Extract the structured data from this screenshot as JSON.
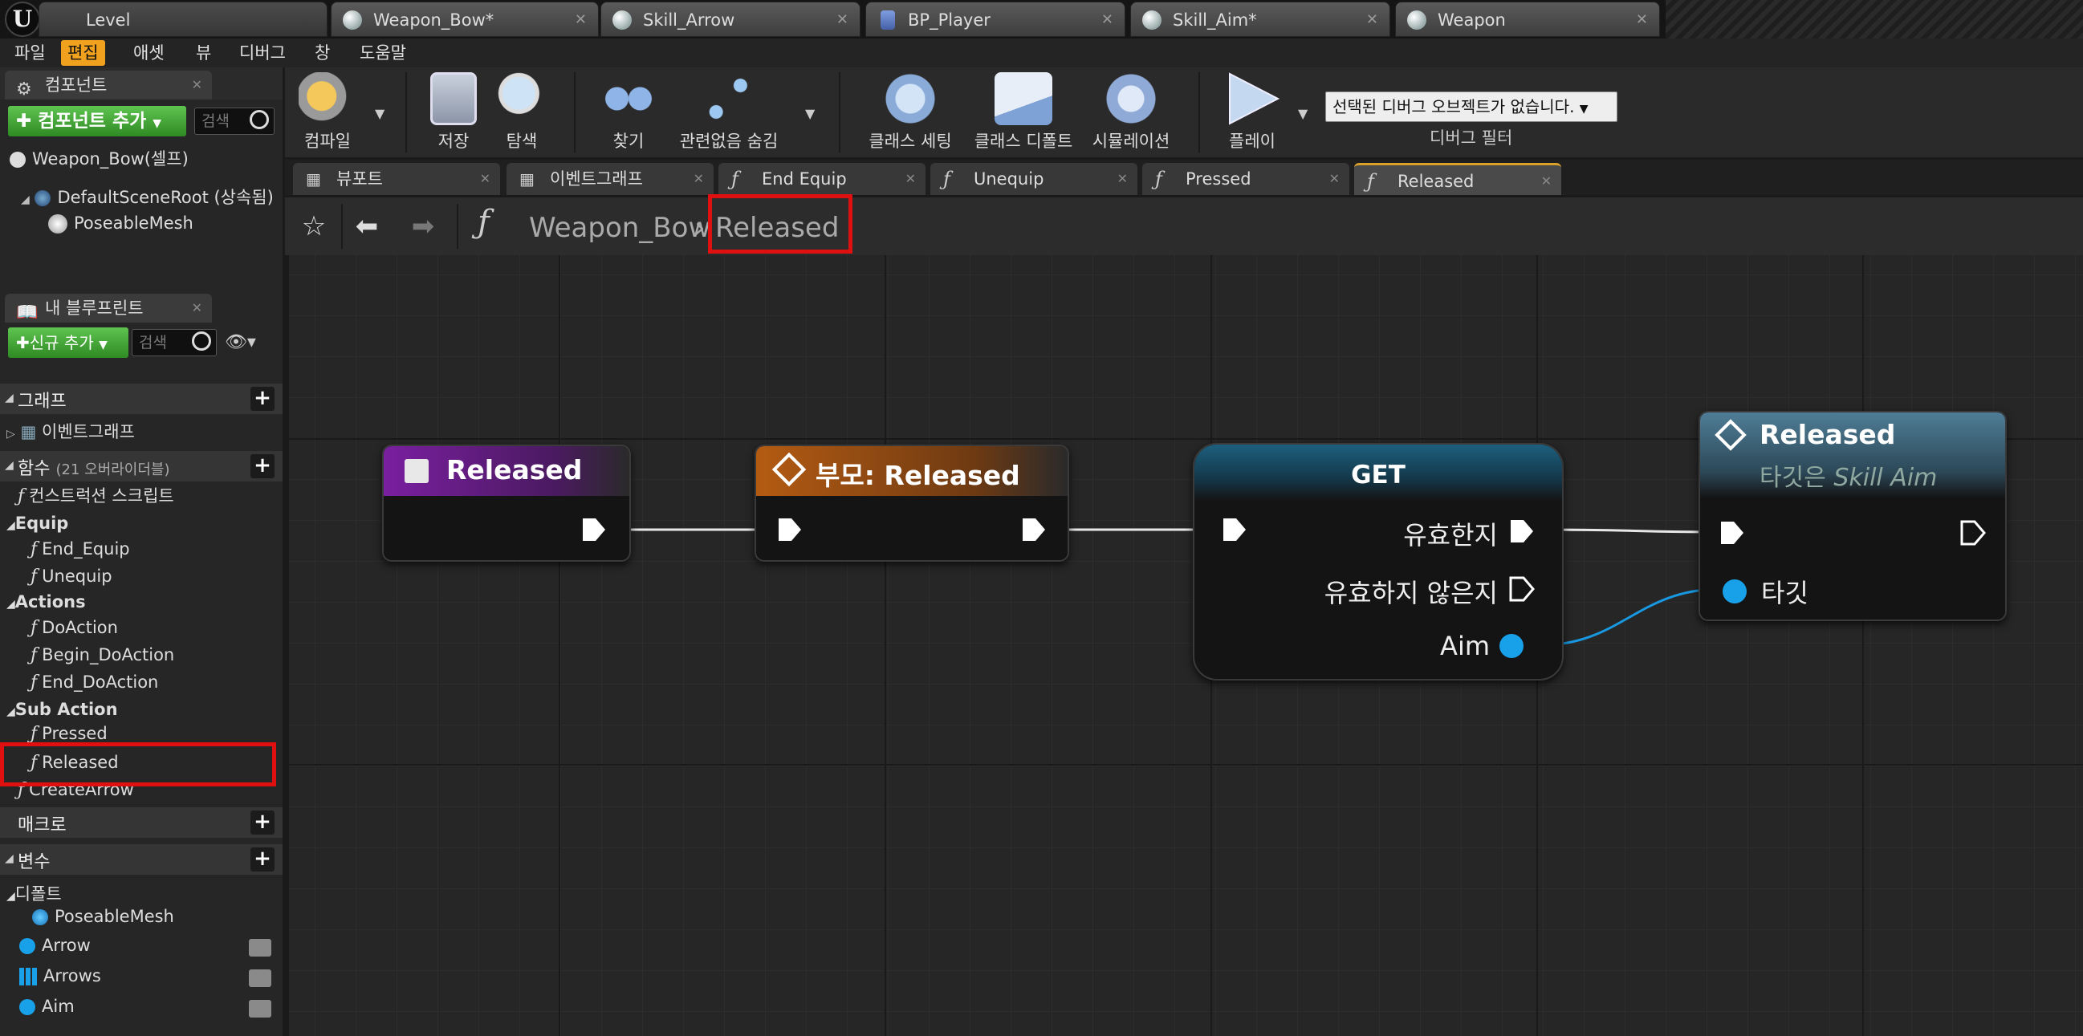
{
  "document_tabs": [
    {
      "label": "Level"
    },
    {
      "label": "Weapon_Bow*"
    },
    {
      "label": "Skill_Arrow"
    },
    {
      "label": "BP_Player"
    },
    {
      "label": "Skill_Aim*"
    },
    {
      "label": "Weapon"
    }
  ],
  "menu": [
    "파일",
    "편집",
    "애셋",
    "뷰",
    "디버그",
    "창",
    "도움말"
  ],
  "components": {
    "tab_label": "컴포넌트",
    "add_button": "컴포넌트 추가",
    "search_placeholder": "검색",
    "self_item": "Weapon_Bow(셀프)",
    "items": [
      "DefaultSceneRoot (상속됨)",
      "PoseableMesh"
    ]
  },
  "my_blueprint": {
    "tab_label": "내 블루프린트",
    "add_new": "신규 추가",
    "search_placeholder": "검색",
    "graph_section": "그래프",
    "event_graph": "이벤트그래프",
    "functions_section": "함수",
    "functions_sub": "(21 오버라이더블)",
    "construction_script": "컨스트럭션 스크립트",
    "categories": [
      {
        "name": "Equip",
        "items": [
          "End_Equip",
          "Unequip"
        ]
      },
      {
        "name": "Actions",
        "items": [
          "DoAction",
          "Begin_DoAction",
          "End_DoAction"
        ]
      },
      {
        "name": "Sub Action",
        "items": [
          "Pressed",
          "Released"
        ]
      }
    ],
    "create_arrow": "CreateArrow",
    "macros_section": "매크로",
    "variables_section": "변수",
    "default_category": "디폴트",
    "variables": [
      "PoseableMesh",
      "Arrow",
      "Arrows",
      "Aim"
    ]
  },
  "toolbar": {
    "compile": "컴파일",
    "save": "저장",
    "browse": "탐색",
    "find": "찾기",
    "hide_unrelated": "관련없음 숨김",
    "class_settings": "클래스 세팅",
    "class_defaults": "클래스 디폴트",
    "simulation": "시뮬레이션",
    "play": "플레이",
    "debug_object": "선택된 디버그 오브젝트가 없습니다.",
    "debug_filter": "디버그 필터"
  },
  "graph_tabs": [
    "뷰포트",
    "이벤트그래프",
    "End Equip",
    "Unequip",
    "Pressed",
    "Released"
  ],
  "breadcrumb": {
    "path": "Weapon_Bow",
    "current": "Released"
  },
  "nodes": {
    "entry": {
      "title": "Released"
    },
    "parent": {
      "title": "부모: Released"
    },
    "get": {
      "title": "GET",
      "valid": "유효한지",
      "not_valid": "유효하지 않은지",
      "aim": "Aim"
    },
    "call": {
      "title": "Released",
      "subtitle_prefix": "타깃은 ",
      "subtitle_target": "Skill Aim",
      "target": "타깃"
    }
  },
  "colors": {
    "accent": "#f0a21e",
    "entry_header": "#7a1fa0",
    "parent_header": "#b45b12",
    "get_header": "#2a7ea0",
    "call_header": "#4f7d96",
    "object_pin": "#18a0e8",
    "highlight": "#e01010"
  }
}
